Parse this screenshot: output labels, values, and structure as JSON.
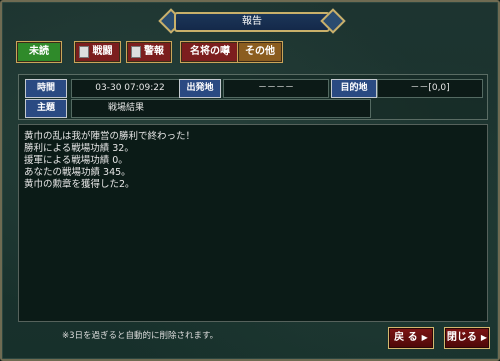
{
  "window": {
    "title": "報告"
  },
  "tabs": [
    {
      "label": "未読",
      "color": "#2c8a2c"
    },
    {
      "label": "戦闘",
      "color": "#7a1e1e"
    },
    {
      "label": "警報",
      "color": "#7a1e1e"
    },
    {
      "label": "名将の噂",
      "color": "#7a1e1e"
    },
    {
      "label": "その他",
      "color": "#8b5d1f"
    }
  ],
  "info": {
    "time_label": "時間",
    "time_value": "03-30 07:09:22",
    "from_label": "出発地",
    "from_value": "－－－－",
    "dest_label": "目的地",
    "dest_value": "－－[0,0]",
    "subject_label": "主題",
    "subject_value": "戦場結果"
  },
  "body": {
    "lines": [
      "黄巾の乱は我が陣営の勝利で終わった！",
      " 勝利による戦場功績 32。",
      " 援軍による戦場功績 0。",
      " あなたの戦場功績 345。",
      " 黄巾の勲章を獲得した2。"
    ]
  },
  "footer": {
    "note": "※3日を過ぎると自動的に削除されます。",
    "back_label": "戻 る",
    "close_label": "閉じる"
  }
}
